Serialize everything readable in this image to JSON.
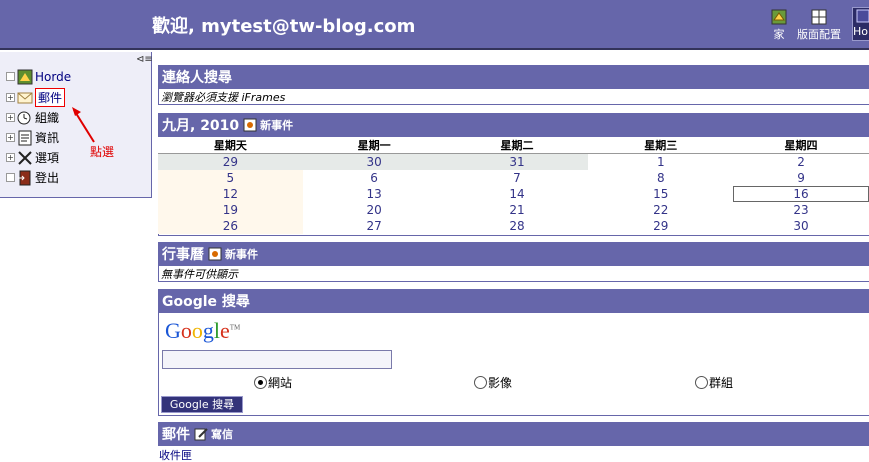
{
  "header": {
    "welcome": "歡迎, mytest@tw-blog.com",
    "buttons": {
      "home": "家",
      "layout": "版面配置",
      "horde": "Horde"
    }
  },
  "sidebar": {
    "collapse_icon": "collapse-sidebar-icon",
    "items": [
      {
        "label": "Horde",
        "icon": "horde-icon"
      },
      {
        "label": "郵件",
        "icon": "envelope-icon"
      },
      {
        "label": "組織",
        "icon": "organizer-icon"
      },
      {
        "label": "資訊",
        "icon": "info-icon"
      },
      {
        "label": "選項",
        "icon": "tools-icon"
      },
      {
        "label": "登出",
        "icon": "logout-icon"
      }
    ],
    "annotation": "點選"
  },
  "contacts_panel": {
    "title": "連絡人搜尋",
    "message": "瀏覽器必須支援 iFrames"
  },
  "calendar_panel": {
    "title": "九月, 2010",
    "new_event": "新事件",
    "weekdays": [
      "星期天",
      "星期一",
      "星期二",
      "星期三",
      "星期四"
    ],
    "weeks": [
      [
        "29",
        "30",
        "31",
        "1",
        "2"
      ],
      [
        "5",
        "6",
        "7",
        "8",
        "9"
      ],
      [
        "12",
        "13",
        "14",
        "15",
        "16"
      ],
      [
        "19",
        "20",
        "21",
        "22",
        "23"
      ],
      [
        "26",
        "27",
        "28",
        "29",
        "30"
      ]
    ]
  },
  "agenda_panel": {
    "title": "行事曆",
    "new_event": "新事件",
    "message": "無事件可供顯示"
  },
  "google_panel": {
    "title": "Google 搜尋",
    "logo": "Google",
    "logo_tm": "TM",
    "search_value": "",
    "options": [
      "網站",
      "影像",
      "群組"
    ],
    "selected": "網站",
    "button": "Google 搜尋"
  },
  "mail_panel": {
    "title": "郵件",
    "compose": "寫信",
    "inbox": "收件匣"
  },
  "colors": {
    "header_bg": "#6666aa",
    "sidebar_bg": "#eeeef8",
    "annotation_red": "#e00000"
  }
}
